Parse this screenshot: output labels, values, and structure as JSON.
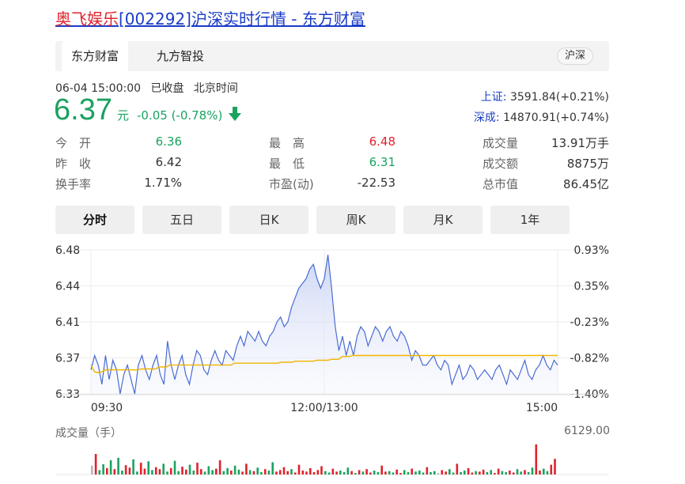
{
  "page": {
    "title_name": "奥飞娱乐",
    "title_code": "[002292]",
    "title_rest": "沪深实时行情 - 东方财富"
  },
  "source_tabs": [
    {
      "label": "东方财富",
      "active": true
    },
    {
      "label": "九方智投",
      "active": false
    }
  ],
  "market_badge": "沪深",
  "meta": {
    "datetime": "06-04 15:00:00",
    "status": "已收盘",
    "timezone": "北京时间"
  },
  "quote": {
    "price": "6.37",
    "unit": "元",
    "change": "-0.05 (-0.78%)",
    "color_down": "#1aa260"
  },
  "indices": [
    {
      "name": "上证:",
      "value": "3591.84(+0.21%)"
    },
    {
      "name": "深成:",
      "value": "14870.91(+0.74%)"
    }
  ],
  "stats": {
    "open_label": "今　开",
    "open": "6.36",
    "prev_label": "昨　收",
    "prev": "6.42",
    "turnover_label": "换手率",
    "turnover": "1.71%",
    "high_label": "最　高",
    "high": "6.48",
    "low_label": "最　低",
    "low": "6.31",
    "pe_label": "市盈(动)",
    "pe": "-22.53",
    "volume_label": "成交量",
    "volume": "13.91万手",
    "amount_label": "成交额",
    "amount": "8875万",
    "mcap_label": "总市值",
    "mcap": "86.45亿"
  },
  "period_tabs": [
    {
      "label": "分时",
      "active": true
    },
    {
      "label": "五日",
      "active": false
    },
    {
      "label": "日K",
      "active": false
    },
    {
      "label": "周K",
      "active": false
    },
    {
      "label": "月K",
      "active": false
    },
    {
      "label": "1年",
      "active": false
    }
  ],
  "chart_data": {
    "type": "line",
    "y_ticks_left": [
      "6.48",
      "6.44",
      "6.41",
      "6.37",
      "6.33"
    ],
    "y_ticks_right": [
      "0.93%",
      "0.35%",
      "-0.23%",
      "-0.82%",
      "-1.40%"
    ],
    "x_ticks": [
      "09:30",
      "12:00/13:00",
      "15:00"
    ],
    "ylim": [
      6.33,
      6.48
    ],
    "price_color": "#4a6cd4",
    "avg_color": "#f0b400",
    "series": [
      {
        "values": [
          6.355,
          6.37,
          6.36,
          6.34,
          6.37,
          6.345,
          6.365,
          6.355,
          6.33,
          6.35,
          6.36,
          6.345,
          6.33,
          6.36,
          6.37,
          6.355,
          6.345,
          6.36,
          6.37,
          6.35,
          6.34,
          6.385,
          6.36,
          6.345,
          6.36,
          6.37,
          6.35,
          6.34,
          6.36,
          6.375,
          6.37,
          6.355,
          6.35,
          6.365,
          6.375,
          6.365,
          6.36,
          6.375,
          6.37,
          6.365,
          6.38,
          6.39,
          6.38,
          6.395,
          6.39,
          6.385,
          6.395,
          6.385,
          6.38,
          6.39,
          6.395,
          6.405,
          6.41,
          6.4,
          6.405,
          6.42,
          6.43,
          6.44,
          6.445,
          6.45,
          6.46,
          6.465,
          6.45,
          6.44,
          6.45,
          6.475,
          6.44,
          6.4,
          6.375,
          6.39,
          6.37,
          6.385,
          6.37,
          6.39,
          6.4,
          6.395,
          6.38,
          6.39,
          6.4,
          6.395,
          6.385,
          6.395,
          6.4,
          6.39,
          6.385,
          6.395,
          6.39,
          6.38,
          6.365,
          6.375,
          6.37,
          6.36,
          6.36,
          6.365,
          6.37,
          6.36,
          6.355,
          6.365,
          6.36,
          6.34,
          6.35,
          6.36,
          6.345,
          6.35,
          6.36,
          6.355,
          6.345,
          6.35,
          6.355,
          6.35,
          6.345,
          6.355,
          6.36,
          6.35,
          6.34,
          6.355,
          6.35,
          6.345,
          6.355,
          6.365,
          6.35,
          6.345,
          6.355,
          6.36,
          6.37,
          6.36,
          6.355,
          6.365,
          6.36
        ]
      },
      {
        "values": [
          6.36,
          6.353,
          6.352,
          6.353,
          6.355,
          6.355,
          6.355,
          6.355,
          6.355,
          6.355,
          6.355,
          6.355,
          6.355,
          6.355,
          6.356,
          6.356,
          6.356,
          6.356,
          6.356,
          6.358,
          6.358,
          6.358,
          6.36,
          6.36,
          6.36,
          6.36,
          6.36,
          6.36,
          6.36,
          6.36,
          6.36,
          6.36,
          6.36,
          6.36,
          6.36,
          6.36,
          6.36,
          6.36,
          6.36,
          6.36,
          6.362,
          6.362,
          6.362,
          6.362,
          6.362,
          6.362,
          6.362,
          6.362,
          6.362,
          6.362,
          6.362,
          6.362,
          6.362,
          6.363,
          6.363,
          6.363,
          6.363,
          6.364,
          6.364,
          6.364,
          6.364,
          6.364,
          6.364,
          6.365,
          6.365,
          6.365,
          6.365,
          6.366,
          6.366,
          6.366,
          6.369,
          6.369,
          6.369,
          6.37,
          6.37,
          6.37,
          6.37,
          6.37,
          6.37,
          6.37,
          6.37,
          6.37,
          6.37,
          6.37,
          6.37,
          6.37,
          6.37,
          6.37,
          6.37,
          6.37,
          6.37,
          6.37,
          6.37,
          6.37,
          6.37,
          6.37,
          6.37,
          6.37,
          6.37,
          6.37,
          6.37,
          6.37,
          6.37,
          6.37,
          6.37,
          6.37,
          6.37,
          6.37,
          6.37,
          6.37,
          6.37,
          6.37,
          6.37,
          6.37,
          6.37,
          6.37,
          6.37,
          6.37,
          6.37,
          6.37,
          6.37,
          6.37,
          6.37,
          6.37,
          6.37,
          6.37,
          6.37,
          6.37,
          6.37,
          6.37,
          6.37
        ]
      }
    ]
  },
  "volume": {
    "label": "成交量（手）",
    "max_label": "6129.00",
    "max": 6129,
    "values": [
      1800,
      4200,
      900,
      2100,
      1300,
      2900,
      1100,
      3400,
      800,
      1900,
      1400,
      3100,
      600,
      2400,
      1200,
      2700,
      900,
      1500,
      1100,
      2200,
      600,
      1300,
      2800,
      700,
      1600,
      1000,
      2000,
      800,
      2400,
      1100,
      600,
      1700,
      900,
      1200,
      2900,
      700,
      1300,
      800,
      1800,
      1000,
      600,
      2200,
      900,
      700,
      1400,
      500,
      1100,
      800,
      2500,
      600,
      900,
      1500,
      700,
      1100,
      400,
      2000,
      800,
      600,
      1300,
      500,
      900,
      1700,
      700,
      400,
      1200,
      600,
      800,
      500,
      1400,
      700,
      300,
      900,
      600,
      1100,
      400,
      800,
      500,
      1800,
      600,
      700,
      400,
      1000,
      300,
      900,
      500,
      1200,
      600,
      800,
      400,
      1500,
      500,
      700,
      300,
      900,
      600,
      1100,
      400,
      2200,
      500,
      800,
      1300,
      400,
      700,
      600,
      1000,
      500,
      900,
      300,
      1200,
      700,
      500,
      800,
      400,
      1100,
      600,
      900,
      500,
      1400,
      6129,
      800,
      1200,
      700,
      2000,
      3200
    ]
  }
}
